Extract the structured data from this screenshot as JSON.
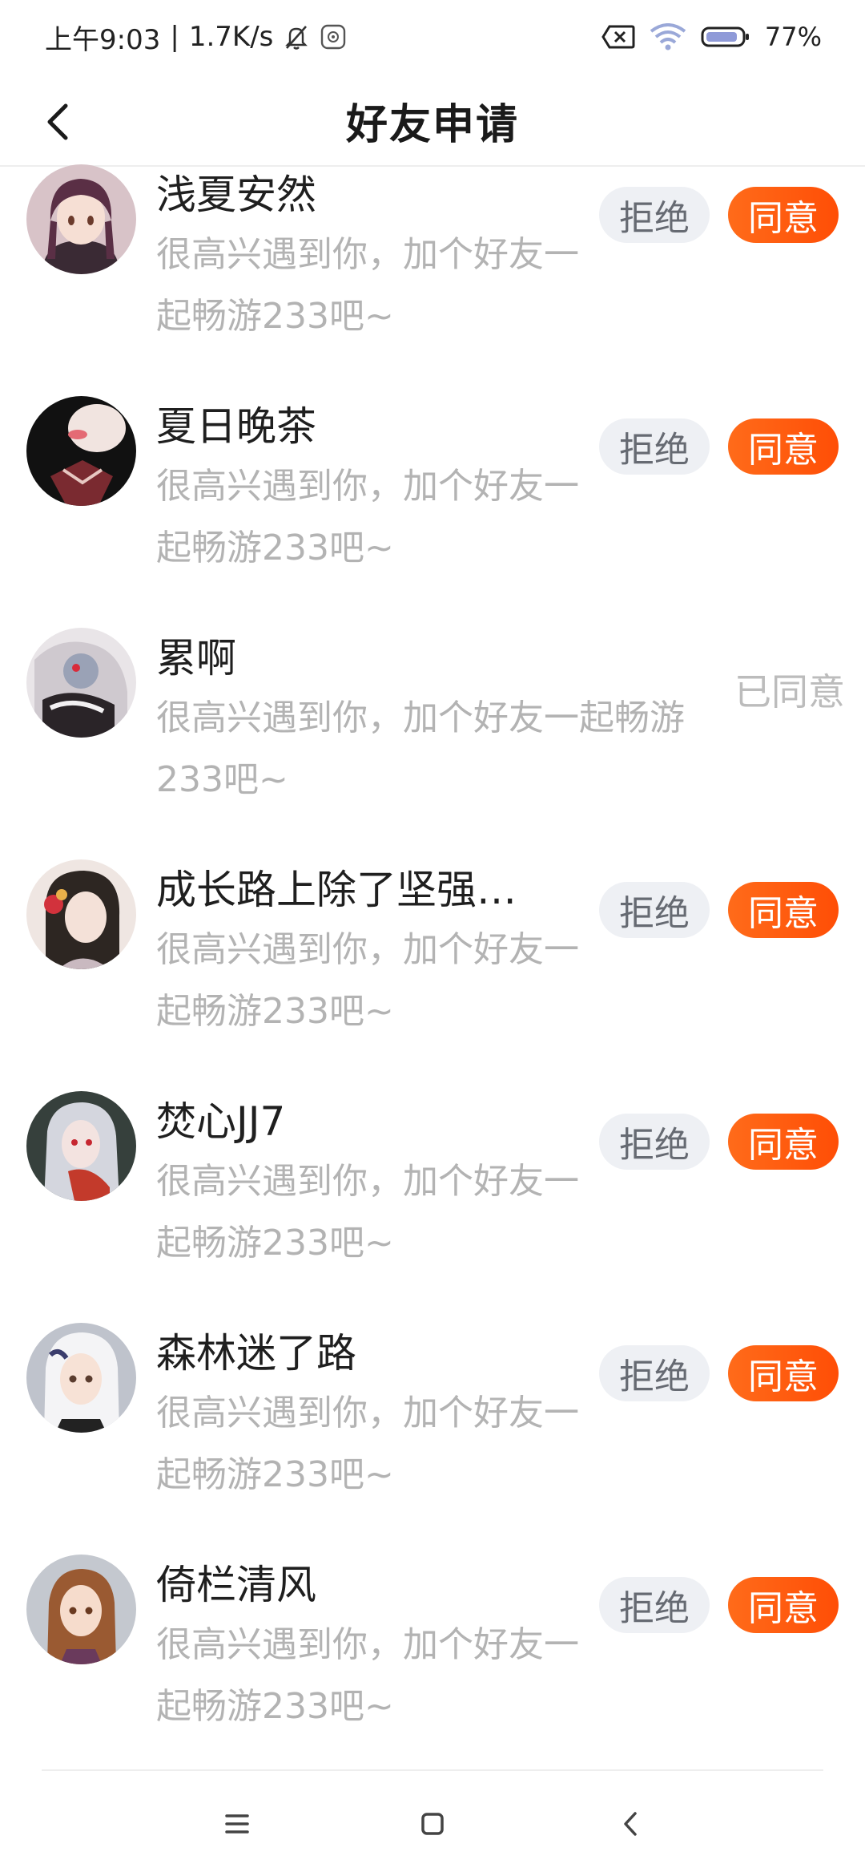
{
  "status_bar": {
    "time": "上午9:03",
    "separator": "|",
    "network_speed": "1.7K/s",
    "battery_percent": "77%",
    "icons": [
      "mute-bell-icon",
      "app-notification-icon",
      "no-sim-icon",
      "wifi-icon",
      "battery-icon"
    ]
  },
  "header": {
    "title": "好友申请",
    "back_icon": "chevron-left-icon"
  },
  "requests": [
    {
      "name": "浅夏安然",
      "message": "很高兴遇到你，加个好友一起畅游233吧~",
      "reject_label": "拒绝",
      "accept_label": "同意",
      "status": "pending"
    },
    {
      "name": "夏日晚茶",
      "message": "很高兴遇到你，加个好友一起畅游233吧~",
      "reject_label": "拒绝",
      "accept_label": "同意",
      "status": "pending"
    },
    {
      "name": "累啊",
      "message": "很高兴遇到你，加个好友一起畅游233吧~",
      "status": "accepted",
      "status_label": "已同意"
    },
    {
      "name": "成长路上除了坚强…",
      "message": "很高兴遇到你，加个好友一起畅游233吧~",
      "reject_label": "拒绝",
      "accept_label": "同意",
      "status": "pending"
    },
    {
      "name": "焚心JJ7",
      "message": "很高兴遇到你，加个好友一起畅游233吧~",
      "reject_label": "拒绝",
      "accept_label": "同意",
      "status": "pending"
    },
    {
      "name": "森林迷了路",
      "message": "很高兴遇到你，加个好友一起畅游233吧~",
      "reject_label": "拒绝",
      "accept_label": "同意",
      "status": "pending"
    },
    {
      "name": "倚栏清风",
      "message": "很高兴遇到你，加个好友一起畅游233吧~",
      "reject_label": "拒绝",
      "accept_label": "同意",
      "status": "pending"
    }
  ],
  "navigation": {
    "icons": [
      "menu-icon",
      "home-square-icon",
      "back-chevron-icon"
    ]
  },
  "colors": {
    "accent": "#FF5A0F",
    "reject_bg": "#EEF0F4",
    "muted_text": "#B3B3B3"
  }
}
